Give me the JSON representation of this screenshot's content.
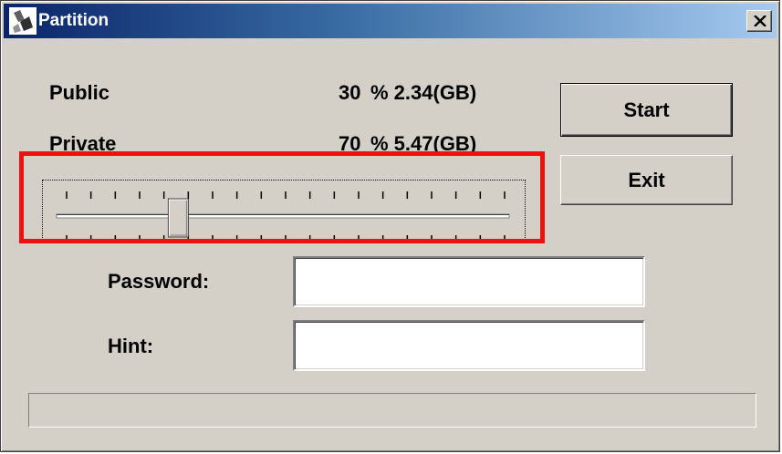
{
  "window": {
    "title": "Partition",
    "close_label": "×"
  },
  "partition": {
    "public": {
      "label": "Public",
      "percent": "30",
      "size": "% 2.34(GB)"
    },
    "private": {
      "label": "Private",
      "percent": "70",
      "size": "% 5.47(GB)"
    }
  },
  "slider": {
    "value_percent": 30,
    "tick_count": 19
  },
  "buttons": {
    "start": "Start",
    "exit": "Exit"
  },
  "fields": {
    "password_label": "Password:",
    "password_value": "",
    "hint_label": "Hint:",
    "hint_value": ""
  },
  "status": {
    "text": ""
  },
  "colors": {
    "highlight": "#ee1111",
    "title_gradient_start": "#0a246a",
    "title_gradient_end": "#a6caf0",
    "face": "#d4d0c8"
  }
}
